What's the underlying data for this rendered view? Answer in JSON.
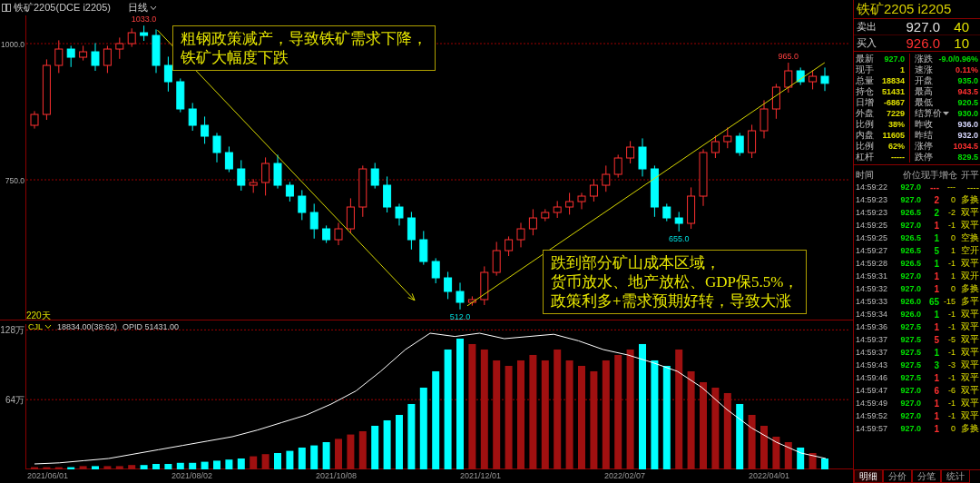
{
  "toolbar": {
    "symbol": "铁矿2205(DCE i2205)",
    "period": "日线"
  },
  "price_chart": {
    "period_label": "220天",
    "notes": [
      {
        "lines": [
          "粗钢政策减产，导致铁矿需求下降，",
          "铁矿大幅度下跌"
        ]
      },
      {
        "lines": [
          "跌到部分矿山成本区域，",
          "货币放水、地产放松、GDP保5.5%，",
          "政策利多+需求预期好转，导致大涨"
        ]
      }
    ],
    "trend_lines": [
      {
        "kind": "arrow"
      },
      {
        "kind": "line"
      }
    ],
    "chart_data": {
      "type": "candlestick",
      "ylim": [
        491.7,
        1051.7
      ],
      "yticks": [
        {
          "value": 750,
          "label": "750.0"
        },
        {
          "value": 1000,
          "label": "1000.0"
        }
      ],
      "ohlc": [
        [
          850,
          876,
          844,
          870
        ],
        [
          870,
          971,
          860,
          960
        ],
        [
          960,
          1006,
          946,
          990
        ],
        [
          990,
          996,
          957,
          975
        ],
        [
          975,
          996,
          969,
          985
        ],
        [
          985,
          1001,
          950,
          960
        ],
        [
          960,
          996,
          946,
          990
        ],
        [
          990,
          1011,
          972,
          1000
        ],
        [
          1000,
          1028,
          994,
          1020
        ],
        [
          1020,
          1033,
          1005,
          1015
        ],
        [
          1015,
          1026,
          946,
          960
        ],
        [
          960,
          976,
          912,
          930
        ],
        [
          930,
          936,
          874,
          880
        ],
        [
          880,
          891,
          840,
          850
        ],
        [
          850,
          866,
          816,
          830
        ],
        [
          830,
          836,
          782,
          800
        ],
        [
          800,
          811,
          764,
          770
        ],
        [
          770,
          786,
          730,
          740
        ],
        [
          740,
          751,
          726,
          745
        ],
        [
          745,
          791,
          721,
          780
        ],
        [
          780,
          796,
          734,
          740
        ],
        [
          740,
          746,
          710,
          720
        ],
        [
          720,
          731,
          676,
          690
        ],
        [
          690,
          706,
          642,
          660
        ],
        [
          660,
          666,
          634,
          640
        ],
        [
          640,
          671,
          630,
          660
        ],
        [
          660,
          716,
          652,
          700
        ],
        [
          700,
          776,
          682,
          770
        ],
        [
          770,
          781,
          734,
          740
        ],
        [
          740,
          756,
          690,
          700
        ],
        [
          700,
          706,
          666,
          680
        ],
        [
          680,
          691,
          622,
          640
        ],
        [
          640,
          656,
          594,
          600
        ],
        [
          600,
          606,
          560,
          570
        ],
        [
          570,
          581,
          531,
          545
        ],
        [
          545,
          561,
          512,
          525
        ],
        [
          525,
          536,
          519,
          530
        ],
        [
          530,
          591,
          520,
          580
        ],
        [
          580,
          636,
          574,
          620
        ],
        [
          620,
          646,
          610,
          640
        ],
        [
          640,
          671,
          626,
          660
        ],
        [
          660,
          696,
          648,
          680
        ],
        [
          680,
          696,
          674,
          690
        ],
        [
          690,
          711,
          680,
          700
        ],
        [
          700,
          726,
          686,
          710
        ],
        [
          710,
          726,
          696,
          720
        ],
        [
          720,
          751,
          710,
          740
        ],
        [
          740,
          776,
          728,
          760
        ],
        [
          760,
          796,
          754,
          790
        ],
        [
          790,
          821,
          780,
          810
        ],
        [
          810,
          826,
          756,
          770
        ],
        [
          770,
          776,
          682,
          700
        ],
        [
          700,
          706,
          674,
          680
        ],
        [
          680,
          691,
          655,
          670
        ],
        [
          670,
          736,
          660,
          720
        ],
        [
          720,
          806,
          702,
          800
        ],
        [
          800,
          831,
          790,
          820
        ],
        [
          820,
          846,
          808,
          830
        ],
        [
          830,
          836,
          794,
          800
        ],
        [
          800,
          851,
          790,
          840
        ],
        [
          840,
          896,
          826,
          880
        ],
        [
          880,
          926,
          862,
          920
        ],
        [
          920,
          965,
          910,
          950
        ],
        [
          950,
          956,
          924,
          930
        ],
        [
          930,
          951,
          916,
          940
        ],
        [
          940,
          956,
          913,
          927
        ]
      ],
      "annotations": [
        "1033.0",
        "512.0",
        "655.0",
        "965.0"
      ]
    }
  },
  "volume_chart": {
    "name": "CJL",
    "reading": "18834.00(38:62)",
    "oi_reading": "OPID 51431.00",
    "chart_data": {
      "type": "bar",
      "ylim": [
        0,
        133.3
      ],
      "yticks": [
        {
          "value": 64,
          "label": "64万"
        },
        {
          "value": 128,
          "label": "128万"
        }
      ],
      "stacked": true,
      "series": [
        {
          "color": "#00ffff",
          "values": [
            null,
            null,
            null,
            2,
            null,
            3,
            null,
            null,
            null,
            4,
            5,
            5,
            6,
            6,
            7,
            8,
            9,
            10,
            null,
            null,
            15,
            17,
            20,
            22,
            25,
            null,
            null,
            null,
            40,
            45,
            50,
            60,
            75,
            90,
            110,
            120,
            null,
            null,
            null,
            null,
            null,
            null,
            null,
            null,
            null,
            null,
            null,
            null,
            null,
            null,
            115,
            100,
            95,
            null,
            null,
            null,
            null,
            null,
            60,
            null,
            null,
            null,
            null,
            20,
            null,
            10
          ]
        },
        {
          "color": "#a01010",
          "values": [
            2,
            2,
            2,
            null,
            3,
            null,
            3,
            3,
            4,
            null,
            null,
            null,
            null,
            null,
            null,
            null,
            null,
            null,
            12,
            14,
            null,
            null,
            null,
            null,
            null,
            28,
            32,
            35,
            null,
            null,
            null,
            null,
            null,
            null,
            null,
            null,
            115,
            110,
            100,
            95,
            100,
            105,
            100,
            110,
            100,
            95,
            90,
            100,
            105,
            110,
            null,
            null,
            null,
            110,
            90,
            80,
            75,
            70,
            null,
            50,
            40,
            30,
            25,
            null,
            15,
            null
          ]
        }
      ]
    }
  },
  "date_labels": [
    "2021/06/01",
    "2021/08/02",
    "2021/10/08",
    "2021/12/01",
    "2022/02/07",
    "2022/04/01"
  ],
  "quote": {
    "title": "铁矿2205  i2205",
    "book": [
      {
        "label": "卖出",
        "price": "927.0",
        "volume": "40",
        "color": "#e0e0e0"
      },
      {
        "label": "买入",
        "price": "926.0",
        "volume": "10",
        "color": "#ff3030"
      }
    ],
    "stats": [
      {
        "label": "最新",
        "value": "927.0",
        "color": "#00e000"
      },
      {
        "label": "涨跌",
        "value": "-9.0/0.96%",
        "color": "#00e000"
      },
      {
        "label": "现手",
        "value": "1",
        "color": "#e0e000"
      },
      {
        "label": "速涨",
        "value": "0.11%",
        "color": "#ff3030"
      },
      {
        "label": "总量",
        "value": "18834",
        "color": "#e0e000"
      },
      {
        "label": "开盘",
        "value": "935.0",
        "color": "#00e000"
      },
      {
        "label": "持仓",
        "value": "51431",
        "color": "#e0e000"
      },
      {
        "label": "最高",
        "value": "943.5",
        "color": "#ff3030"
      },
      {
        "label": "日增",
        "value": "-6867",
        "color": "#e0e000"
      },
      {
        "label": "最低",
        "value": "920.5",
        "color": "#00e000"
      },
      {
        "label": "外盘",
        "value": "7229",
        "color": "#e0e000"
      },
      {
        "label": "结算价",
        "value": "930.0",
        "color": "#00e000",
        "menu": true
      },
      {
        "label": "比例",
        "value": "38%",
        "color": "#e0e000"
      },
      {
        "label": "昨收",
        "value": "936.0",
        "color": "#d8d8ff"
      },
      {
        "label": "内盘",
        "value": "11605",
        "color": "#e0e000"
      },
      {
        "label": "昨结",
        "value": "932.0",
        "color": "#d8d8ff"
      },
      {
        "label": "比例",
        "value": "62%",
        "color": "#e0e000"
      },
      {
        "label": "涨停",
        "value": "1034.5",
        "color": "#ff3030"
      },
      {
        "label": "杠杆",
        "value": "-----",
        "color": "#e0e000"
      },
      {
        "label": "跌停",
        "value": "829.5",
        "color": "#00e000"
      }
    ],
    "trade_columns": [
      "时间",
      "价位",
      "现手",
      "增仓",
      "开平"
    ],
    "trades": [
      {
        "time": "14:59:22",
        "price": "927.0",
        "hand": "---",
        "change": "---",
        "type": "----",
        "color": "#ff3030"
      },
      {
        "time": "14:59:23",
        "price": "927.0",
        "hand": "2",
        "change": "0",
        "type": "多换",
        "color": "#ff3030"
      },
      {
        "time": "14:59:23",
        "price": "926.5",
        "hand": "2",
        "change": "-2",
        "type": "双平",
        "color": "#00e000"
      },
      {
        "time": "14:59:25",
        "price": "927.0",
        "hand": "1",
        "change": "-1",
        "type": "双平",
        "color": "#ff3030"
      },
      {
        "time": "14:59:25",
        "price": "926.5",
        "hand": "1",
        "change": "0",
        "type": "空换",
        "color": "#00e000"
      },
      {
        "time": "14:59:27",
        "price": "926.5",
        "hand": "5",
        "change": "1",
        "type": "空开",
        "color": "#00e000"
      },
      {
        "time": "14:59:28",
        "price": "926.5",
        "hand": "1",
        "change": "-1",
        "type": "双平",
        "color": "#00e000"
      },
      {
        "time": "14:59:31",
        "price": "927.0",
        "hand": "1",
        "change": "1",
        "type": "双开",
        "color": "#ff3030"
      },
      {
        "time": "14:59:32",
        "price": "927.0",
        "hand": "1",
        "change": "0",
        "type": "多换",
        "color": "#ff3030"
      },
      {
        "time": "14:59:33",
        "price": "926.0",
        "hand": "65",
        "change": "-15",
        "type": "多平",
        "color": "#00e000"
      },
      {
        "time": "14:59:34",
        "price": "926.0",
        "hand": "1",
        "change": "-1",
        "type": "双平",
        "color": "#00e000"
      },
      {
        "time": "14:59:36",
        "price": "927.5",
        "hand": "1",
        "change": "-1",
        "type": "双平",
        "color": "#ff3030"
      },
      {
        "time": "14:59:37",
        "price": "927.5",
        "hand": "5",
        "change": "-5",
        "type": "双平",
        "color": "#ff3030"
      },
      {
        "time": "14:59:37",
        "price": "927.5",
        "hand": "1",
        "change": "-1",
        "type": "双平",
        "color": "#00e000"
      },
      {
        "time": "14:59:43",
        "price": "927.5",
        "hand": "3",
        "change": "-3",
        "type": "双平",
        "color": "#00e000"
      },
      {
        "time": "14:59:46",
        "price": "927.5",
        "hand": "1",
        "change": "-1",
        "type": "双平",
        "color": "#ff3030"
      },
      {
        "time": "14:59:47",
        "price": "927.0",
        "hand": "6",
        "change": "-6",
        "type": "双平",
        "color": "#ff3030"
      },
      {
        "time": "14:59:49",
        "price": "927.0",
        "hand": "1",
        "change": "-1",
        "type": "双平",
        "color": "#ff3030"
      },
      {
        "time": "14:59:52",
        "price": "927.0",
        "hand": "1",
        "change": "-1",
        "type": "双平",
        "color": "#ff3030"
      },
      {
        "time": "14:59:57",
        "price": "927.0",
        "hand": "1",
        "change": "0",
        "type": "多换",
        "color": "#ff3030"
      }
    ],
    "tabs": [
      {
        "label": "明细",
        "selected": true
      },
      {
        "label": "分价",
        "selected": false
      },
      {
        "label": "分笔",
        "selected": false
      },
      {
        "label": "统计",
        "selected": false
      }
    ]
  }
}
